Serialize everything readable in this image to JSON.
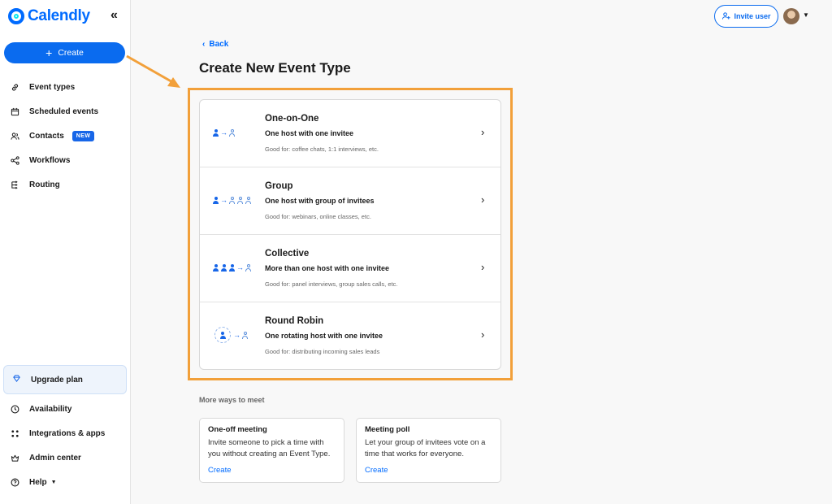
{
  "app": {
    "logo_text": "Calendly",
    "collapse_glyph": "«"
  },
  "sidebar": {
    "create_label": "Create",
    "items": [
      {
        "label": "Event types",
        "icon": "link-icon"
      },
      {
        "label": "Scheduled events",
        "icon": "calendar-icon"
      },
      {
        "label": "Contacts",
        "icon": "contacts-icon",
        "badge": "NEW"
      },
      {
        "label": "Workflows",
        "icon": "workflow-icon"
      },
      {
        "label": "Routing",
        "icon": "routing-icon"
      }
    ],
    "upgrade_label": "Upgrade plan",
    "bottom_items": [
      {
        "label": "Availability",
        "icon": "clock-icon"
      },
      {
        "label": "Integrations & apps",
        "icon": "grid-icon"
      },
      {
        "label": "Admin center",
        "icon": "crown-icon"
      },
      {
        "label": "Help",
        "icon": "help-icon"
      }
    ]
  },
  "header": {
    "invite_label": "Invite user"
  },
  "main": {
    "back_label": "Back",
    "title": "Create New Event Type",
    "event_types": [
      {
        "title": "One-on-One",
        "subtitle": "One host with one invitee",
        "good_for": "Good for: coffee chats, 1:1 interviews, etc."
      },
      {
        "title": "Group",
        "subtitle": "One host with group of invitees",
        "good_for": "Good for: webinars, online classes, etc."
      },
      {
        "title": "Collective",
        "subtitle": "More than one host with one invitee",
        "good_for": "Good for: panel interviews, group sales calls, etc."
      },
      {
        "title": "Round Robin",
        "subtitle": "One rotating host with one invitee",
        "good_for": "Good for: distributing incoming sales leads"
      }
    ],
    "more_ways_label": "More ways to meet",
    "more_ways": [
      {
        "title": "One-off meeting",
        "description": "Invite someone to pick a time with you without creating an Event Type.",
        "link": "Create"
      },
      {
        "title": "Meeting poll",
        "description": "Let your group of invitees vote on a time that works for everyone.",
        "link": "Create"
      }
    ]
  },
  "colors": {
    "brand": "#006bff",
    "highlight": "#f2a03a"
  }
}
